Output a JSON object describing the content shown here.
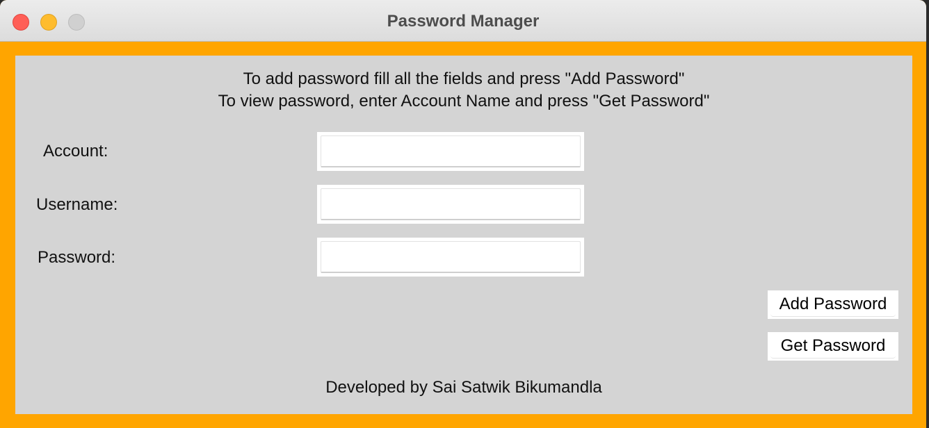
{
  "window": {
    "title": "Password Manager",
    "accent_color": "#ffa500",
    "panel_color": "#d4d4d4"
  },
  "instructions": {
    "line1": "To add password fill all the fields and press \"Add Password\"",
    "line2": "To view password, enter Account Name and press \"Get Password\""
  },
  "form": {
    "account_label": "Account:",
    "account_value": "",
    "username_label": "Username:",
    "username_value": "",
    "password_label": "Password:",
    "password_value": ""
  },
  "buttons": {
    "add_label": "Add Password",
    "get_label": "Get Password"
  },
  "footer": {
    "text": "Developed by Sai Satwik Bikumandla"
  }
}
